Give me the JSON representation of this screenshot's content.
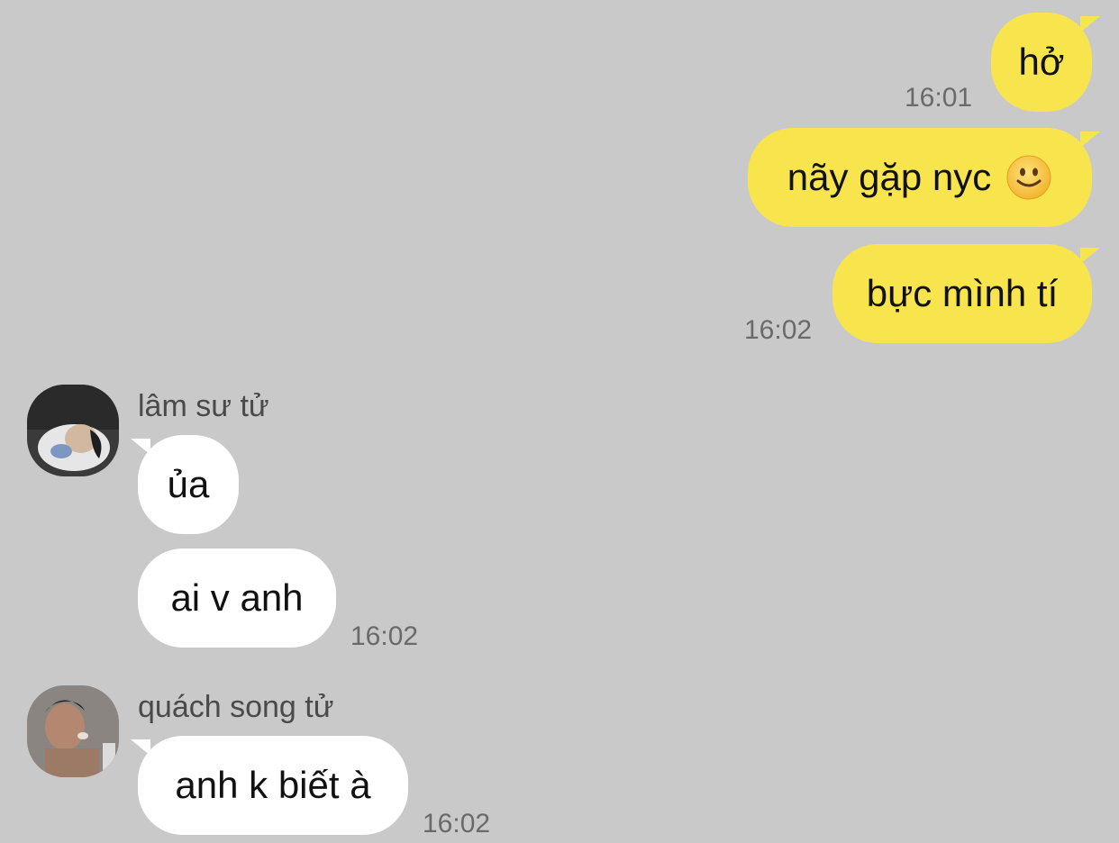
{
  "outgoing": [
    {
      "text": "hở",
      "time": "16:01"
    },
    {
      "text": "nãy gặp nyc",
      "emoji": "slightly-smiling-face-icon"
    },
    {
      "text": "bực mình tí",
      "time": "16:02"
    }
  ],
  "incoming": [
    {
      "sender": "lâm sư tử",
      "avatar": "user-avatar-lam",
      "messages": [
        {
          "text": "ủa"
        },
        {
          "text": "ai v anh",
          "time": "16:02"
        }
      ]
    },
    {
      "sender": "quách song tử",
      "avatar": "user-avatar-quach",
      "messages": [
        {
          "text": "anh k biết à",
          "time": "16:02"
        }
      ]
    }
  ],
  "colors": {
    "background": "#c9c9c9",
    "outgoing_bubble": "#f8e54e",
    "incoming_bubble": "#ffffff",
    "timestamp": "#6a6a6a"
  }
}
